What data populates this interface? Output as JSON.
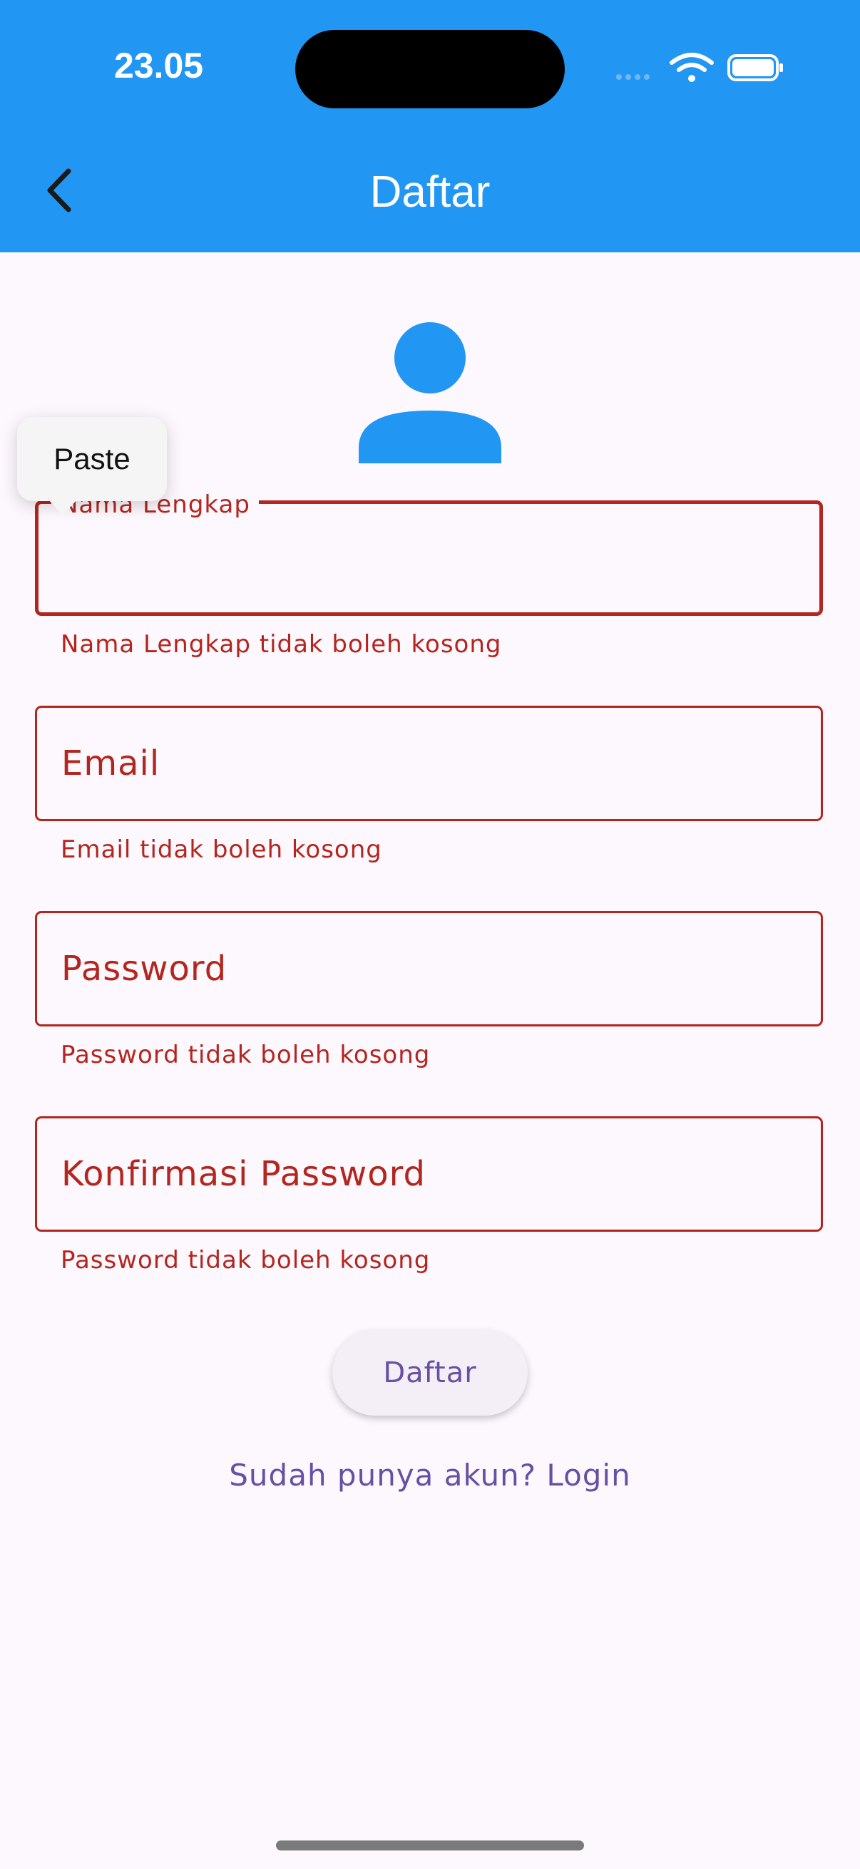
{
  "status_bar": {
    "time": "23.05",
    "icons": [
      "cellular-signal-icon",
      "wifi-icon",
      "battery-icon"
    ]
  },
  "app_bar": {
    "title": "Daftar",
    "back_icon": "chevron-left-icon",
    "color": "#2196F3"
  },
  "avatar_icon": "person-icon",
  "context_menu": {
    "paste_label": "Paste"
  },
  "form": {
    "full_name": {
      "label": "Nama Lengkap",
      "value": "",
      "error": "Nama Lengkap tidak boleh kosong"
    },
    "email": {
      "label": "Email",
      "value": "",
      "error": "Email tidak boleh kosong"
    },
    "password": {
      "label": "Password",
      "value": "",
      "error": "Password tidak boleh kosong"
    },
    "confirm_password": {
      "label": "Konfirmasi Password",
      "value": "",
      "error": "Password tidak boleh kosong"
    }
  },
  "submit_label": "Daftar",
  "login_link": "Sudah punya akun? Login",
  "colors": {
    "error": "#B3261E",
    "accent": "#6750A4",
    "background": "#FDF7FE",
    "primary": "#2196F3"
  }
}
